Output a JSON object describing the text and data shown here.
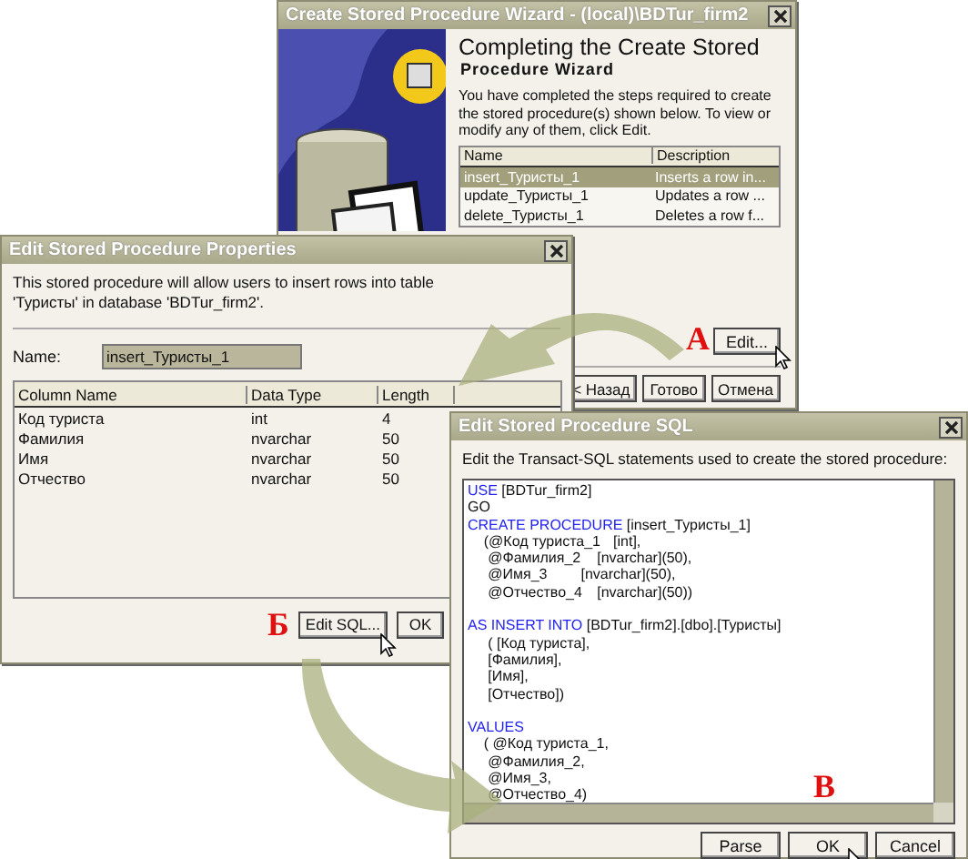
{
  "wizard": {
    "title": "Create Stored Procedure Wizard - (local)\\BDTur_firm2",
    "heading": "Completing the Create Stored",
    "subheading": "Procedure Wizard",
    "text": "You have completed the steps required to create the stored procedure(s) shown below. To view or modify any of them, click Edit.",
    "columns": [
      "Name",
      "Description"
    ],
    "rows": [
      {
        "name": "insert_Туристы_1",
        "description": "Inserts a row in...",
        "selected": true
      },
      {
        "name": "update_Туристы_1",
        "description": "Updates a row ...",
        "selected": false
      },
      {
        "name": "delete_Туристы_1",
        "description": "Deletes a row f...",
        "selected": false
      }
    ],
    "edit_button": "Edit...",
    "buttons": [
      "< Назад",
      "Готово",
      "Отмена"
    ],
    "marker": "А"
  },
  "properties": {
    "title": "Edit Stored Procedure Properties",
    "text": "This stored procedure will allow users to insert rows into table 'Туристы' in database 'BDTur_firm2'.",
    "name_label": "Name:",
    "name_value": "insert_Туристы_1",
    "columns": [
      "Column Name",
      "Data Type",
      "Length"
    ],
    "rows": [
      [
        "Код туриста",
        "int",
        "4"
      ],
      [
        "Фамилия",
        "nvarchar",
        "50"
      ],
      [
        "Имя",
        "nvarchar",
        "50"
      ],
      [
        "Отчество",
        "nvarchar",
        "50"
      ]
    ],
    "buttons": [
      "Edit SQL...",
      "OK"
    ],
    "marker": "Б"
  },
  "sql": {
    "title": "Edit Stored Procedure SQL",
    "text": "Edit the Transact-SQL statements used to create the stored procedure:",
    "code": [
      {
        "keyword": "USE",
        "text": " [BDTur_firm2]"
      },
      {
        "text": "GO"
      },
      {
        "keyword": "CREATE PROCEDURE",
        "text": " [insert_Туристы_1]"
      },
      {
        "text": "\t(@Код туриста_1 \t[int],"
      },
      {
        "text": "\t @Фамилия_2 \t[nvarchar](50),"
      },
      {
        "text": "\t @Имя_3 \t\t[nvarchar](50),"
      },
      {
        "text": "\t @Отчество_4 \t[nvarchar](50))"
      },
      {
        "keyword": "AS INSERT INTO",
        "text": " [BDTur_firm2].[dbo].[Туристы]",
        "spaced": true
      },
      {
        "text": "\t ( [Код туриста],"
      },
      {
        "text": "\t [Фамилия],"
      },
      {
        "text": "\t [Имя],"
      },
      {
        "text": "\t [Отчество])"
      },
      {
        "keyword": "VALUES",
        "spaced": true
      },
      {
        "text": "\t( @Код туриста_1,"
      },
      {
        "text": "\t @Фамилия_2,"
      },
      {
        "text": "\t @Имя_3,"
      },
      {
        "text": "\t @Отчество_4)"
      }
    ],
    "buttons": [
      "Parse",
      "OK",
      "Cancel"
    ],
    "marker": "В"
  }
}
